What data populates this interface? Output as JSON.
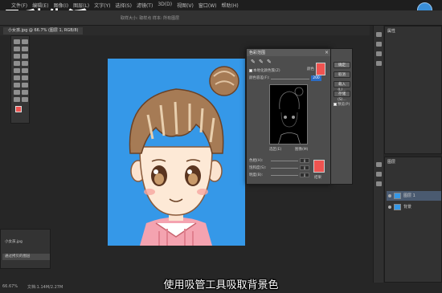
{
  "watermark": "飞秒生活",
  "menubar": {
    "items": [
      "文件(F)",
      "编辑(E)",
      "图像(I)",
      "图层(L)",
      "文字(Y)",
      "选择(S)",
      "滤镜(T)",
      "3D(D)",
      "视图(V)",
      "窗口(W)",
      "帮助(H)"
    ]
  },
  "options_bar": {
    "text": "取样大小: 取样点   样本: 所有图层"
  },
  "document_tab": {
    "title": "小女孩.jpg @ 66.7% (图层 1, RGB/8)"
  },
  "canvas": {
    "background_color": "#3598e8"
  },
  "history_panel": {
    "items": [
      "小女孩.jpg",
      "通过拷贝的图层"
    ]
  },
  "status": {
    "zoom": "66.67%",
    "doc": "文档:1.14M/2.27M"
  },
  "properties_panel": {
    "title": "属性"
  },
  "layers_panel": {
    "title": "图层",
    "layers": [
      {
        "name": "图层 1"
      },
      {
        "name": "背景"
      }
    ]
  },
  "dialog": {
    "title": "色彩范围",
    "close": "×",
    "color_label": "颜色",
    "color_swatch": "#ef5350",
    "local_clusters": "本地化颜色簇(Z)",
    "fuzziness_label": "颜色容差(F):",
    "fuzziness_value": "200",
    "radio_selection": "选区(E)",
    "radio_image": "图像(M)",
    "hue_label": "色相(H):",
    "hue_value": "0",
    "saturation_label": "饱和度(S):",
    "saturation_value": "0",
    "brightness_label": "明度(B):",
    "brightness_value": "0",
    "result_label": "结果",
    "result_swatch": "#ef5350",
    "buttons": {
      "ok": "确定",
      "cancel": "取消",
      "load": "载入(L)...",
      "save": "存储(S)..."
    },
    "preview_check": "预览(P)"
  },
  "subtitle": "使用吸管工具吸取背景色"
}
